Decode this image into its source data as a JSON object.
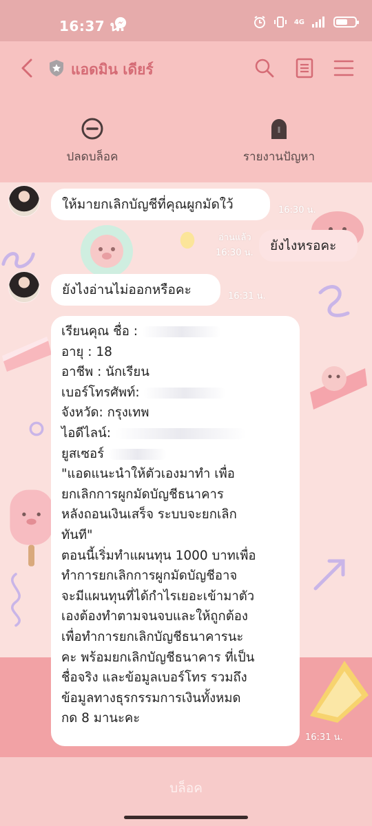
{
  "status_bar": {
    "time": "16:37 น.",
    "network": "4G"
  },
  "header": {
    "title": "แอดมิน เดียร์",
    "actions": [
      {
        "label": "ปลดบล็อค",
        "icon": "unblock-icon"
      },
      {
        "label": "รายงานปัญหา",
        "icon": "report-icon"
      }
    ]
  },
  "messages": [
    {
      "text": "ให้มายกเลิกบัญชีที่คุณผูกมัดใว้",
      "time": "16:30 น."
    },
    {
      "text": "ยังไงหรอคะ",
      "read": "อ่านแล้ว",
      "time": "16:30 น."
    },
    {
      "text": "ยังไงอ่านไม่ออกหรือคะ",
      "time": "16:31 น."
    },
    {
      "lines": [
        "เรียนคุณ ชื่อ : ",
        "อายุ : 18",
        "อาชีพ : นักเรียน",
        "เบอร์โทรศัพท์: ",
        "จังหวัด: กรุงเทพ",
        "ไอดีไลน์: ",
        "ยูสเซอร์ ",
        "\"แอดแนะนำให้ตัวเองมาทำ เพื่อ",
        "ยกเลิกการผูกมัดบัญชีธนาคาร",
        "หลังถอนเงินเสร็จ ระบบจะยกเลิก",
        "ทันที\"",
        "ตอนนี้เริ่มทำแผนทุน 1000 บาทเพื่อ",
        "ทำการยกเลิกการผูกมัดบัญชีอาจ",
        "จะมีแผนทุนที่ได้กำไรเยอะเข้ามาตัว",
        "เองต้องทำตามจนจบและให้ถูกต้อง",
        "เพื่อทำการยกเลิกบัญชีธนาคารนะ",
        "คะ พร้อมยกเลิกบัญชีธนาคาร ที่เป็น",
        "ชื่อจริง และข้อมูลเบอร์โทร รวมถึง",
        "ข้อมูลทางธุรกรรมการเงินทั้งหมด",
        "กด 8 มานะคะ"
      ],
      "time": "16:31 น."
    }
  ],
  "footer": {
    "block_label": "บล็อค"
  },
  "colors": {
    "status_bar": "#e6abab",
    "header": "#f7c2c1",
    "title": "#d56b75",
    "chat_bg": "#fbe0dd"
  }
}
